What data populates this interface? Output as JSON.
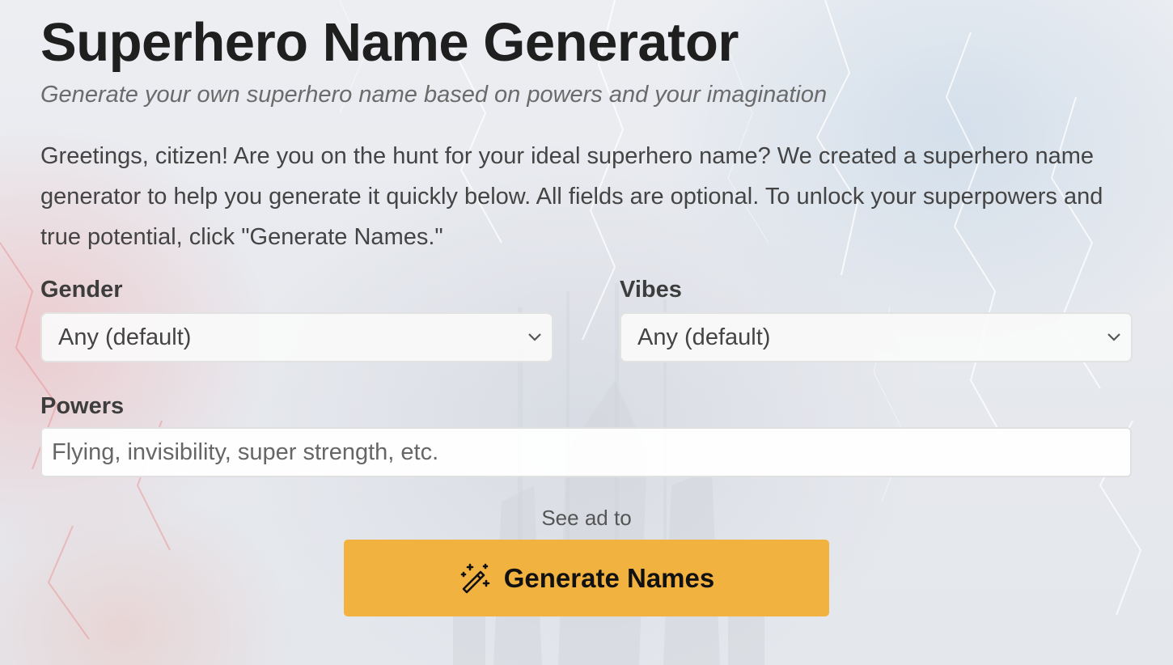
{
  "page": {
    "title": "Superhero Name Generator",
    "subtitle": "Generate your own superhero name based on powers and your imagination",
    "intro": "Greetings, citizen! Are you on the hunt for your ideal superhero name? We created a superhero name generator to help you generate it quickly below. All fields are optional. To unlock your superpowers and true potential, click \"Generate Names.\""
  },
  "form": {
    "gender": {
      "label": "Gender",
      "selected": "Any (default)"
    },
    "vibes": {
      "label": "Vibes",
      "selected": "Any (default)"
    },
    "powers": {
      "label": "Powers",
      "value": "",
      "placeholder": "Flying, invisibility, super strength, etc."
    },
    "ad_note": "See ad to",
    "generate_button": {
      "label": "Generate Names",
      "icon": "magic-wand-icon"
    }
  },
  "colors": {
    "button_bg": "#f2b23f",
    "title": "#1f1f1f",
    "text": "#444444"
  }
}
